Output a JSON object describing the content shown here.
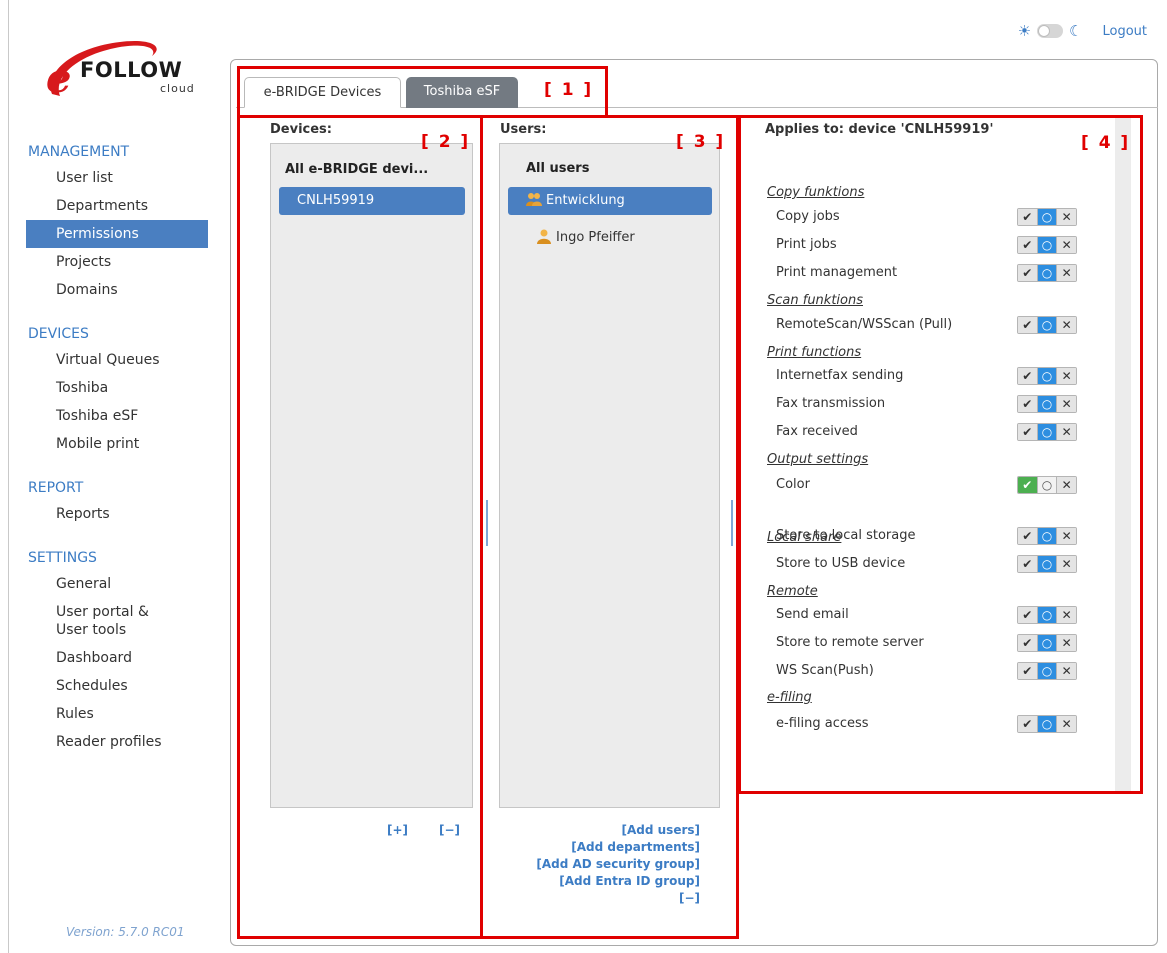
{
  "logo": {
    "brand": "FOLLOW",
    "sub": "cloud",
    "e": "e"
  },
  "topbar": {
    "sun_icon": "sun-icon",
    "moon_icon": "moon-icon",
    "logout": "Logout"
  },
  "sidebar": {
    "sections": [
      {
        "heading": "MANAGEMENT",
        "items": [
          "User list",
          "Departments",
          "Permissions",
          "Projects",
          "Domains"
        ]
      },
      {
        "heading": "DEVICES",
        "items": [
          "Virtual Queues",
          "Toshiba",
          "Toshiba eSF",
          "Mobile print"
        ]
      },
      {
        "heading": "REPORT",
        "items": [
          "Reports"
        ]
      },
      {
        "heading": "SETTINGS",
        "items": [
          "General",
          "User portal &\nUser tools",
          "Dashboard",
          "Schedules",
          "Rules",
          "Reader profiles"
        ]
      }
    ],
    "active_item": "Permissions",
    "version": "Version: 5.7.0 RC01"
  },
  "tabs": {
    "ebridge": "e-BRIDGE Devices",
    "esf": "Toshiba eSF"
  },
  "devices": {
    "title": "Devices:",
    "heading": "All e-BRIDGE devi...",
    "items": [
      "CNLH59919"
    ],
    "add": "[+]",
    "remove": "[−]"
  },
  "users": {
    "title": "Users:",
    "heading": "All users",
    "items": [
      {
        "label": "Entwicklung",
        "icon": "group-icon",
        "selected": true
      },
      {
        "label": "Ingo Pfeiffer",
        "icon": "user-icon",
        "selected": false
      }
    ],
    "links": [
      "[Add users]",
      "[Add departments]",
      "[Add AD security group]",
      "[Add Entra ID group]",
      "[−]"
    ]
  },
  "permissions": {
    "applies_to": "Applies to:",
    "applies_target": "device 'CNLH59919'",
    "toggle_symbols": {
      "yes": "✔",
      "default": "○",
      "no": "✕"
    },
    "categories": [
      {
        "name": "Copy funktions",
        "rows": [
          {
            "label": "Copy jobs",
            "state": "default"
          },
          {
            "label": "Print jobs",
            "state": "default"
          },
          {
            "label": "Print management",
            "state": "default"
          }
        ]
      },
      {
        "name": "Scan funktions",
        "rows": [
          {
            "label": "RemoteScan/WSScan (Pull)",
            "state": "default"
          }
        ]
      },
      {
        "name": "Print functions",
        "rows": [
          {
            "label": "Internetfax sending",
            "state": "default"
          },
          {
            "label": "Fax transmission",
            "state": "default"
          },
          {
            "label": "Fax received",
            "state": "default"
          }
        ]
      },
      {
        "name": "Output settings",
        "rows": [
          {
            "label": "Color",
            "state": "allow"
          }
        ]
      },
      {
        "name": "Local share",
        "rows": [
          {
            "label": "Store to local storage",
            "state": "default"
          },
          {
            "label": "Store to USB device",
            "state": "default"
          }
        ]
      },
      {
        "name": "Remote",
        "rows": [
          {
            "label": "Send email",
            "state": "default"
          },
          {
            "label": "Store to remote server",
            "state": "default"
          },
          {
            "label": "WS Scan(Push)",
            "state": "default"
          }
        ]
      },
      {
        "name": "e-filing",
        "rows": [
          {
            "label": "e-filing access",
            "state": "default"
          }
        ]
      }
    ]
  },
  "annotations": {
    "box1": "[ 1 ]",
    "box2": "[ 2 ]",
    "box3": "[ 3 ]",
    "box4": "[ 4 ]",
    "color": "#e00000"
  }
}
